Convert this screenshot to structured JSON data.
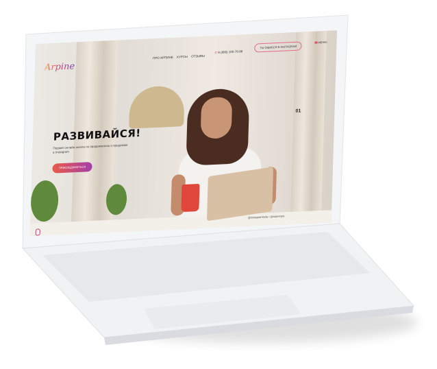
{
  "site": {
    "logo": "Arpine",
    "nav": [
      "ПРО АРПИНЕ",
      "КУРСЫ",
      "ОТЗЫВЫ"
    ],
    "phone": "8 (800) 100-76-88",
    "instagram_button": "ТЫ ОШИБСЯ В INSTAGRAM",
    "menu_label": "МЕНЮ",
    "hero_title": "РАЗВИВАЙСЯ!",
    "hero_subtitle": "Первая онлайн-школа по продвижению и продажам в Instagram",
    "join_button": "ПРИСОЕДИНИТЬСЯ",
    "slide_number": "01",
    "social_handles": "@instagrambola / @arpinegra"
  },
  "colors": {
    "accent": "#e0466a",
    "gradient_start": "#e95a4a",
    "gradient_end": "#a43ea8"
  }
}
